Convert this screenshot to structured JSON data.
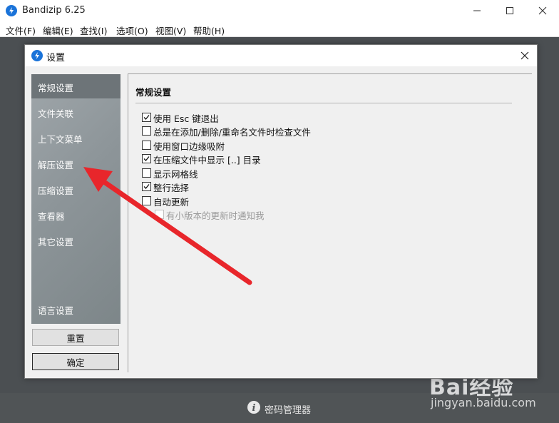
{
  "app": {
    "title": "Bandizip 6.25",
    "menu": [
      "文件(F)",
      "编辑(E)",
      "查找(I)",
      "选项(O)",
      "视图(V)",
      "帮助(H)"
    ],
    "status_label": "密码管理器"
  },
  "dialog": {
    "title": "设置",
    "sidebar": [
      {
        "label": "常规设置",
        "active": true
      },
      {
        "label": "文件关联"
      },
      {
        "label": "上下文菜单"
      },
      {
        "label": "解压设置"
      },
      {
        "label": "压缩设置"
      },
      {
        "label": "查看器"
      },
      {
        "label": "其它设置"
      },
      {
        "label": "语言设置"
      }
    ],
    "reset_label": "重置",
    "ok_label": "确定",
    "section_title": "常规设置",
    "options": [
      {
        "label": "使用 Esc 键退出",
        "checked": true
      },
      {
        "label": "总是在添加/删除/重命名文件时检查文件",
        "checked": false
      },
      {
        "label": "使用窗口边缘吸附",
        "checked": false
      },
      {
        "label": "在压缩文件中显示 [..] 目录",
        "checked": true
      },
      {
        "label": "显示网格线",
        "checked": false
      },
      {
        "label": "整行选择",
        "checked": true
      },
      {
        "label": "自动更新",
        "checked": false
      },
      {
        "label": "有小版本的更新时通知我",
        "checked": false,
        "disabled": true
      }
    ]
  },
  "watermark": {
    "brand": "Bai经验",
    "url": "jingyan.baidu.com"
  },
  "colors": {
    "accent": "#1a73d9",
    "arrow": "#e8262b"
  }
}
